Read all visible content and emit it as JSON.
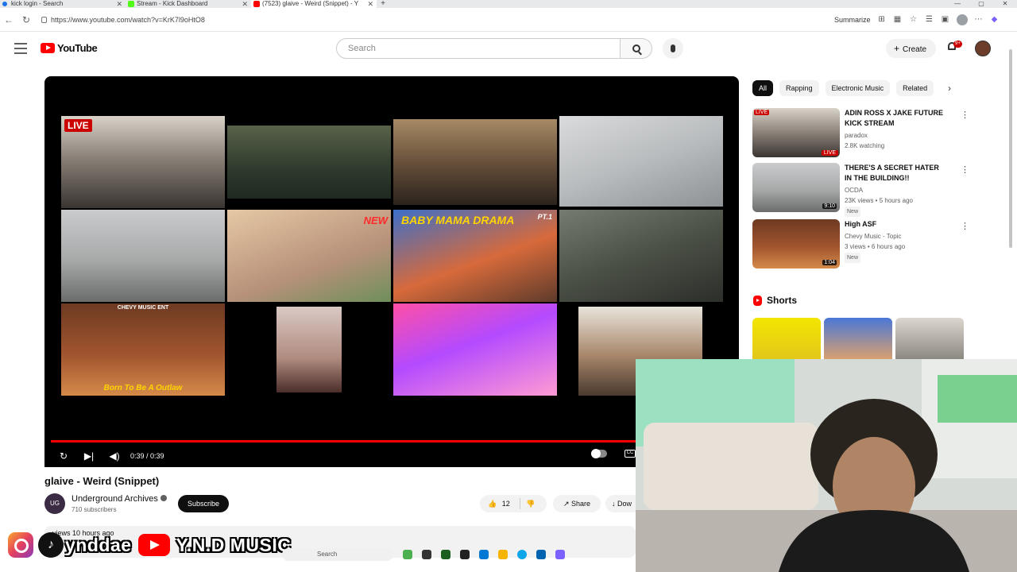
{
  "browser": {
    "tabs": [
      {
        "title": "kick login - Search",
        "color": "#1a73e8"
      },
      {
        "title": "Stream - Kick Dashboard",
        "color": "#53fc18"
      },
      {
        "title": "(7523) glaive - Weird (Snippet) - Y",
        "color": "#ff0000"
      }
    ],
    "url": "https://www.youtube.com/watch?v=KrK7l9oHtO8",
    "summarize_label": "Summarize"
  },
  "youtube": {
    "logo_text": "YouTube",
    "search_placeholder": "Search",
    "create_label": "Create",
    "notif_count": "9+"
  },
  "player": {
    "time": "0:39 / 0:39",
    "progress": 1.0,
    "thumb_labels": {
      "live": "LIVE",
      "new": "NEW",
      "baby_mama": "BABY MAMA DRAMA",
      "pt": "PT.1",
      "chevy": "CHEVY MUSIC ENT",
      "born": "Born To Be A Outlaw"
    }
  },
  "video": {
    "title": "glaive - Weird (Snippet)",
    "channel": "Underground Archives",
    "channel_initials": "UG",
    "subscribers": "710 subscribers",
    "subscribe_label": "Subscribe",
    "likes": "12",
    "share_label": "Share",
    "download_label": "Dow",
    "views_line": "views  10 hours ago"
  },
  "sidebar": {
    "chips": [
      "All",
      "Rapping",
      "Electronic Music",
      "Related"
    ],
    "recs": [
      {
        "title": "ADIN ROSS X JAKE FUTURE KICK STREAM",
        "channel": "paradox",
        "meta": "2.8K watching",
        "badge": "LIVE",
        "duration": ""
      },
      {
        "title": "THERE'S A SECRET HATER IN THE BUILDING!!",
        "channel": "OCDA",
        "meta": "23K views • 5 hours ago",
        "badge": "New",
        "duration": "9:10"
      },
      {
        "title": "High ASF",
        "channel": "Chevy Music - Topic",
        "meta": "3 views • 6 hours ago",
        "badge": "New",
        "duration": "1:04"
      }
    ],
    "shorts_label": "Shorts"
  },
  "overlay": {
    "tiktok_handle": "ynddae",
    "youtube_handle": "Y.N.D MUSIC"
  },
  "taskbar": {
    "search_placeholder": "Search"
  }
}
